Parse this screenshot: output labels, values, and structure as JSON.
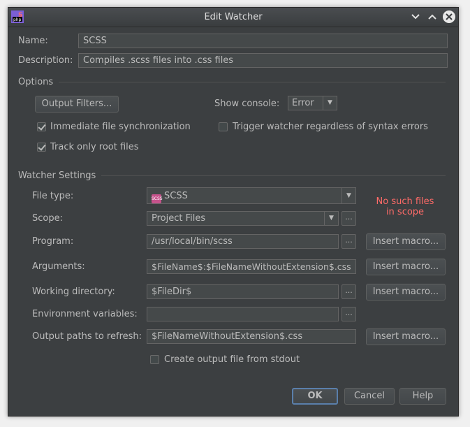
{
  "window": {
    "title": "Edit Watcher",
    "app_icon": "phpstorm-icon",
    "controls": [
      "chevron-down-icon",
      "chevron-up-icon",
      "close-icon"
    ]
  },
  "general": {
    "name_label": "Name:",
    "name_value": "SCSS",
    "description_label": "Description:",
    "description_value": "Compiles .scss files into .css files"
  },
  "options": {
    "section_label": "Options",
    "output_filters_button": "Output Filters...",
    "show_console_label": "Show console:",
    "show_console_value": "Error",
    "immediate_sync_label": "Immediate file synchronization",
    "immediate_sync_checked": true,
    "trigger_regardless_label": "Trigger watcher regardless of syntax errors",
    "trigger_regardless_checked": false,
    "track_root_label": "Track only root files",
    "track_root_checked": true
  },
  "watcher": {
    "section_label": "Watcher Settings",
    "file_type_label": "File type:",
    "file_type_value": "SCSS",
    "file_type_icon_text": "SCSS",
    "scope_label": "Scope:",
    "scope_value": "Project Files",
    "warning_line1": "No such files",
    "warning_line2": "in scope",
    "program_label": "Program:",
    "program_value": "/usr/local/bin/scss",
    "arguments_label": "Arguments:",
    "arguments_value": "$FileName$:$FileNameWithoutExtension$.css",
    "working_dir_label": "Working directory:",
    "working_dir_value": "$FileDir$",
    "env_vars_label": "Environment variables:",
    "env_vars_value": "",
    "output_paths_label": "Output paths to refresh:",
    "output_paths_value": "$FileNameWithoutExtension$.css",
    "insert_macro_label": "Insert macro...",
    "browse_label": "...",
    "create_output_label": "Create output file from stdout",
    "create_output_checked": false
  },
  "footer": {
    "ok_label": "OK",
    "cancel_label": "Cancel",
    "help_label": "Help"
  },
  "colors": {
    "background": "#3c3f41",
    "field": "#45494a",
    "text": "#bbbbbb",
    "warning": "#ff6b68",
    "default_button_border": "#5a7fab"
  }
}
